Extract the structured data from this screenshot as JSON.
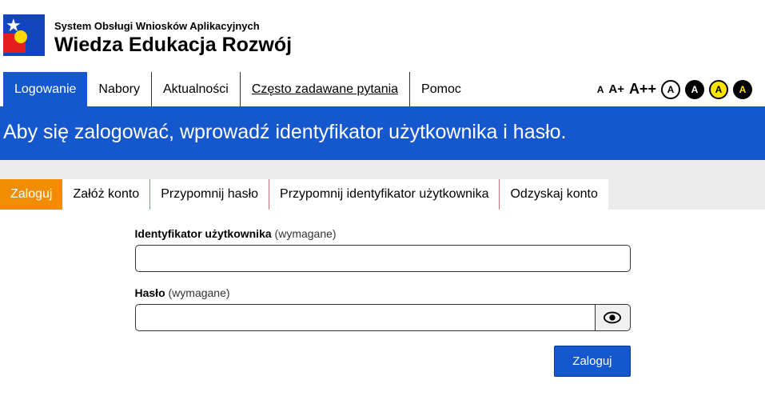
{
  "header": {
    "system_line": "System Obsługi Wniosków Aplikacyjnych",
    "title": "Wiedza Edukacja Rozwój"
  },
  "nav": {
    "items": [
      {
        "label": "Logowanie",
        "active": true
      },
      {
        "label": "Nabory"
      },
      {
        "label": "Aktualności"
      },
      {
        "label": "Często zadawane pytania",
        "underline": true
      },
      {
        "label": "Pomoc"
      }
    ]
  },
  "accessibility": {
    "font_small": "A",
    "font_medium": "A+",
    "font_large": "A++",
    "contrast_labels": [
      "A",
      "A",
      "A",
      "A"
    ]
  },
  "banner": {
    "text": "Aby się zalogować, wprowadź identyfikator użytkownika i hasło."
  },
  "subtabs": {
    "items": [
      {
        "label": "Zaloguj",
        "active": true
      },
      {
        "label": "Załóż konto"
      },
      {
        "label": "Przypomnij hasło"
      },
      {
        "label": "Przypomnij identyfikator użytkownika"
      },
      {
        "label": "Odzyskaj konto"
      }
    ]
  },
  "form": {
    "user_label": "Identyfikator użytkownika",
    "user_req": "(wymagane)",
    "user_value": "",
    "password_label": "Hasło",
    "password_req": "(wymagane)",
    "password_value": "",
    "submit_label": "Zaloguj"
  }
}
